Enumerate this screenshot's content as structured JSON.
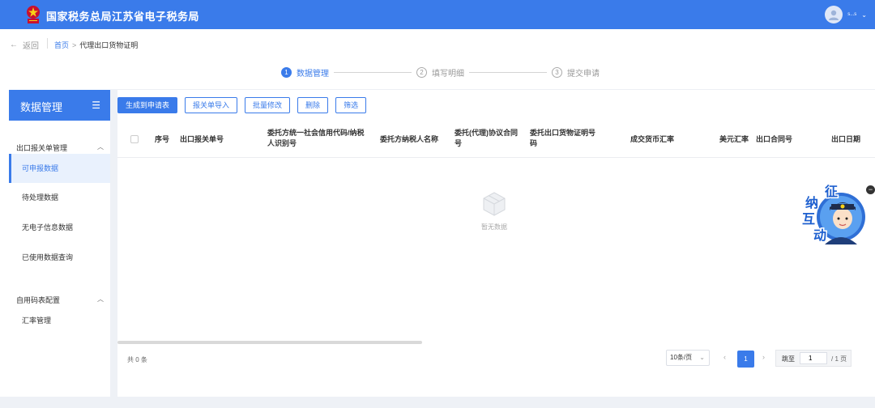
{
  "header": {
    "title": "国家税务总局江苏省电子税务局",
    "user_name": "s...s"
  },
  "breadcrumb": {
    "back": "返回",
    "home": "首页",
    "separator": ">",
    "current": "代理出口货物证明"
  },
  "steps": [
    {
      "num": "1",
      "label": "数据管理",
      "state": "active"
    },
    {
      "num": "2",
      "label": "填写明细",
      "state": "todo"
    },
    {
      "num": "3",
      "label": "提交申请",
      "state": "todo"
    }
  ],
  "sidebar": {
    "title": "数据管理",
    "groups": [
      {
        "label": "出口报关单管理",
        "items": [
          "可申报数据",
          "待处理数据",
          "无电子信息数据",
          "已使用数据查询"
        ]
      },
      {
        "label": "自用码表配置",
        "items": [
          "汇率管理"
        ]
      }
    ],
    "active_item": "可申报数据"
  },
  "toolbar": {
    "buttons": [
      "生成到申请表",
      "报关单导入",
      "批量修改",
      "删除",
      "筛选"
    ]
  },
  "table": {
    "columns": [
      "序号",
      "出口报关单号",
      "委托方统一社会信用代码/纳税人识别号",
      "委托方纳税人名称",
      "委托(代理)协议合同号",
      "委托出口货物证明号码",
      "成交货币汇率",
      "美元汇率",
      "出口合同号",
      "出口日期"
    ],
    "rows": [],
    "empty_text": "暂无数据"
  },
  "pagination": {
    "total": "共 0 条",
    "page_size": "10条/页",
    "current_page": "1",
    "jump_label": "跳至",
    "jump_value": "1",
    "total_pages": "/ 1 页"
  },
  "float_widget": {
    "label": "征纳互动"
  },
  "colors": {
    "primary": "#3a7bea",
    "background": "#eef1f6"
  }
}
